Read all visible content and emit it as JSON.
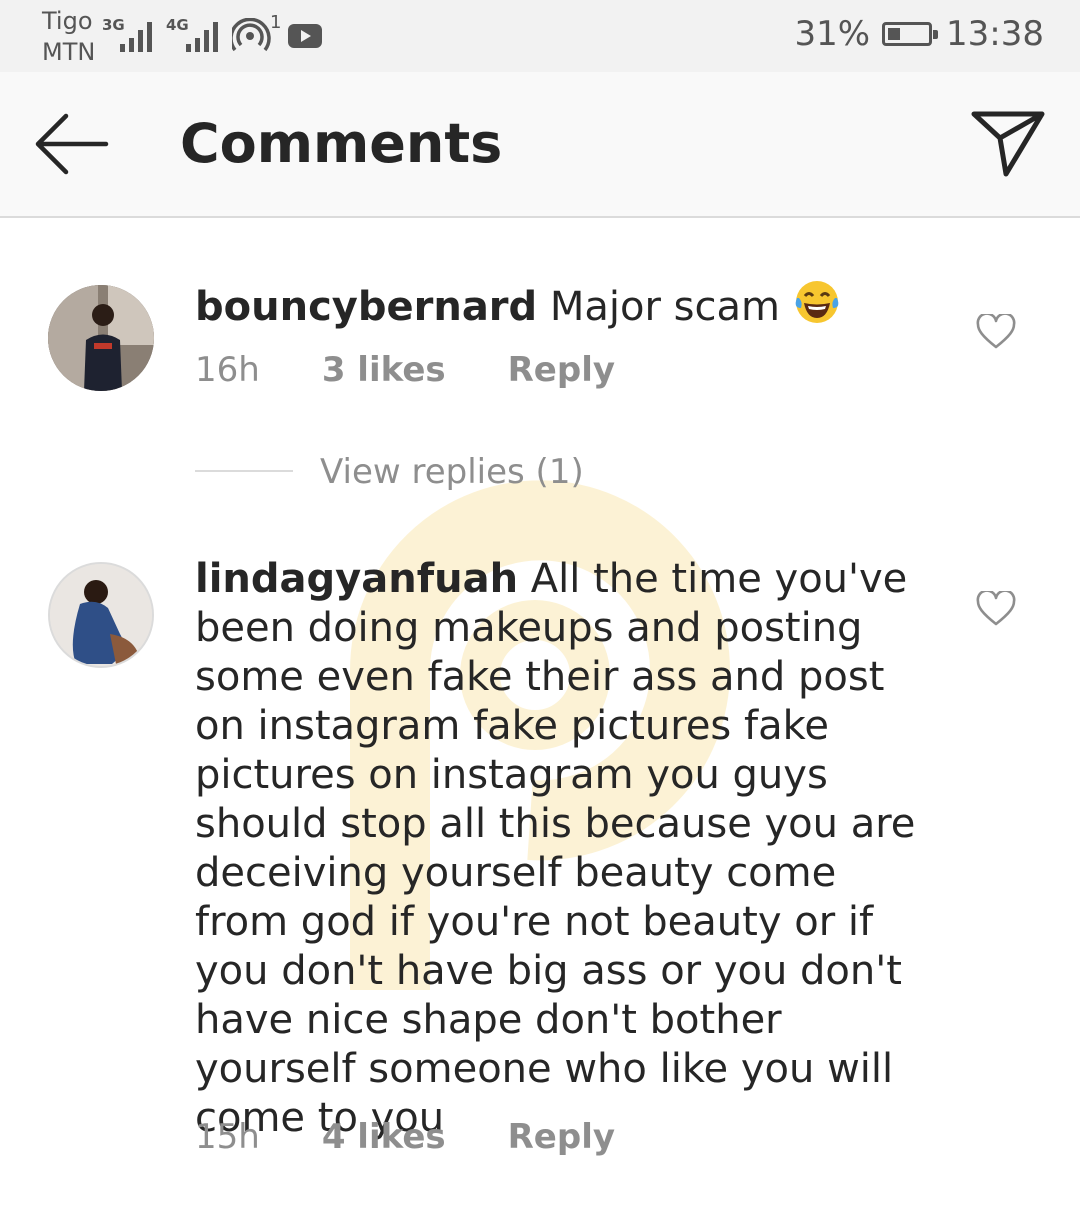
{
  "status_bar": {
    "carrier_line1": "Tigo",
    "carrier_line2": "MTN",
    "network1": "3G",
    "network2": "4G",
    "hotspot_count": "1",
    "battery_percent": "31%",
    "battery_level": 0.31,
    "time": "13:38"
  },
  "header": {
    "title": "Comments"
  },
  "comments": [
    {
      "username": "bouncybernard",
      "text": "Major scam",
      "emoji": "face-with-tears-of-joy",
      "time": "16h",
      "likes": "3 likes",
      "reply_label": "Reply",
      "view_replies": "View replies (1)"
    },
    {
      "username": "lindagyanfuah",
      "text": "All the time you've been doing makeups and posting some even fake their ass and post on instagram fake pictures fake pictures on instagram you guys should stop all this because you are deceiving yourself beauty come from god if you're not beauty or if you don't have big ass or you don't have nice shape don't bother yourself someone who like you will come to you",
      "time": "15h",
      "likes": "4 likes",
      "reply_label": "Reply"
    }
  ],
  "colors": {
    "text": "#262626",
    "secondary": "#8e8e8e",
    "header_bg": "#f9f9f9",
    "statusbar_bg": "#f2f2f2"
  }
}
